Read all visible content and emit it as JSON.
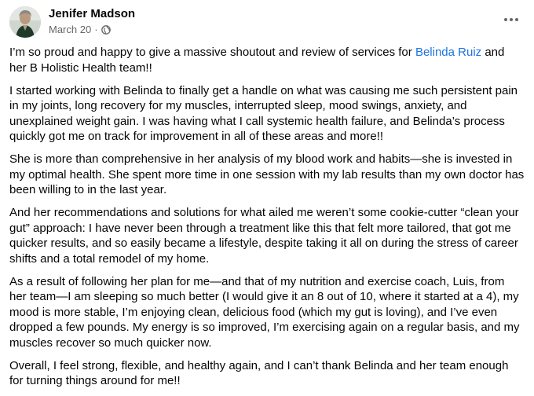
{
  "post": {
    "author": "Jenifer Madson",
    "date": "March 20",
    "separator": "·",
    "privacy_icon": "globe-icon",
    "more_icon": "more-horizontal-icon",
    "mention_color": "#1b74e4",
    "paragraphs": [
      {
        "before": "I’m so proud and happy to give a massive shoutout and review of services for ",
        "mention": "Belinda Ruiz",
        "after": " and her B Holistic Health team!!"
      },
      "I started working with Belinda to finally get a handle on what was causing me such persistent pain in my joints, long recovery for my muscles, interrupted sleep, mood swings, anxiety, and unexplained weight gain. I was having what I call systemic health failure, and Belinda’s process quickly got me on track for improvement in all of these areas and more!!",
      "She is more than comprehensive in her analysis of my blood work and habits—she is invested in my optimal health. She spent more time in one session with my lab results than my own doctor has been willing to in the last year.",
      "And her recommendations and solutions for what ailed me weren’t some cookie-cutter “clean your gut” approach: I have never been through a treatment like this that felt more tailored, that got me quicker results, and so easily became a lifestyle, despite taking it all on during the stress of career shifts and a total remodel of my home.",
      "As a result of following her plan for me—and that of my nutrition and exercise coach, Luis, from her team—I am sleeping so much better (I would give it an 8 out of 10, where it started at a 4), my mood is more stable, I’m enjoying clean, delicious food (which my gut is loving), and I’ve even dropped a few pounds. My energy is so improved, I’m exercising again on a regular basis, and my muscles recover so much quicker now.",
      "Overall, I feel strong, flexible, and healthy again, and I can’t thank Belinda and her team enough for turning things around for me!!"
    ]
  }
}
